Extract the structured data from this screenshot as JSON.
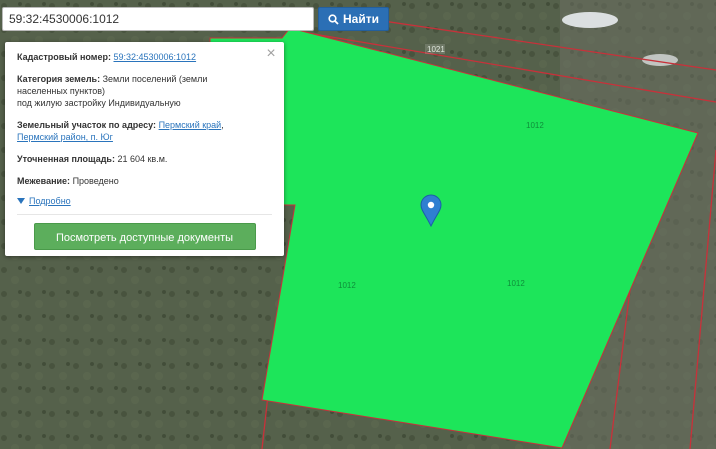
{
  "search": {
    "value": "59:32:4530006:1012",
    "button_label": "Найти",
    "button_icon": "search-icon"
  },
  "popup": {
    "close_icon": "close-icon",
    "cadastral": {
      "label": "Кадастровый номер:",
      "value": "59:32:4530006:1012"
    },
    "category": {
      "label": "Категория земель:",
      "value_line1": "Земли поселений (земли",
      "value_line2": "населенных пунктов)",
      "value_line3": "под жилую застройку Индивидуальную"
    },
    "address": {
      "label": "Земельный участок по адресу:",
      "link1": "Пермский край",
      "sep": ",",
      "link2": "Пермский район, п. Юг"
    },
    "area": {
      "label": "Уточненная площадь:",
      "value": "21 604 кв.м."
    },
    "survey": {
      "label": "Межевание:",
      "value": "Проведено"
    },
    "more_label": "Подробно",
    "docs_button": "Посмотреть доступные документы"
  },
  "map": {
    "parcel_labels": [
      "1012",
      "1012",
      "1012",
      "1021"
    ],
    "parcel_color": "#1de55a",
    "boundary_color": "#c8313a",
    "marker_color": "#2f7fd1",
    "marker_icon": "map-pin-icon"
  }
}
